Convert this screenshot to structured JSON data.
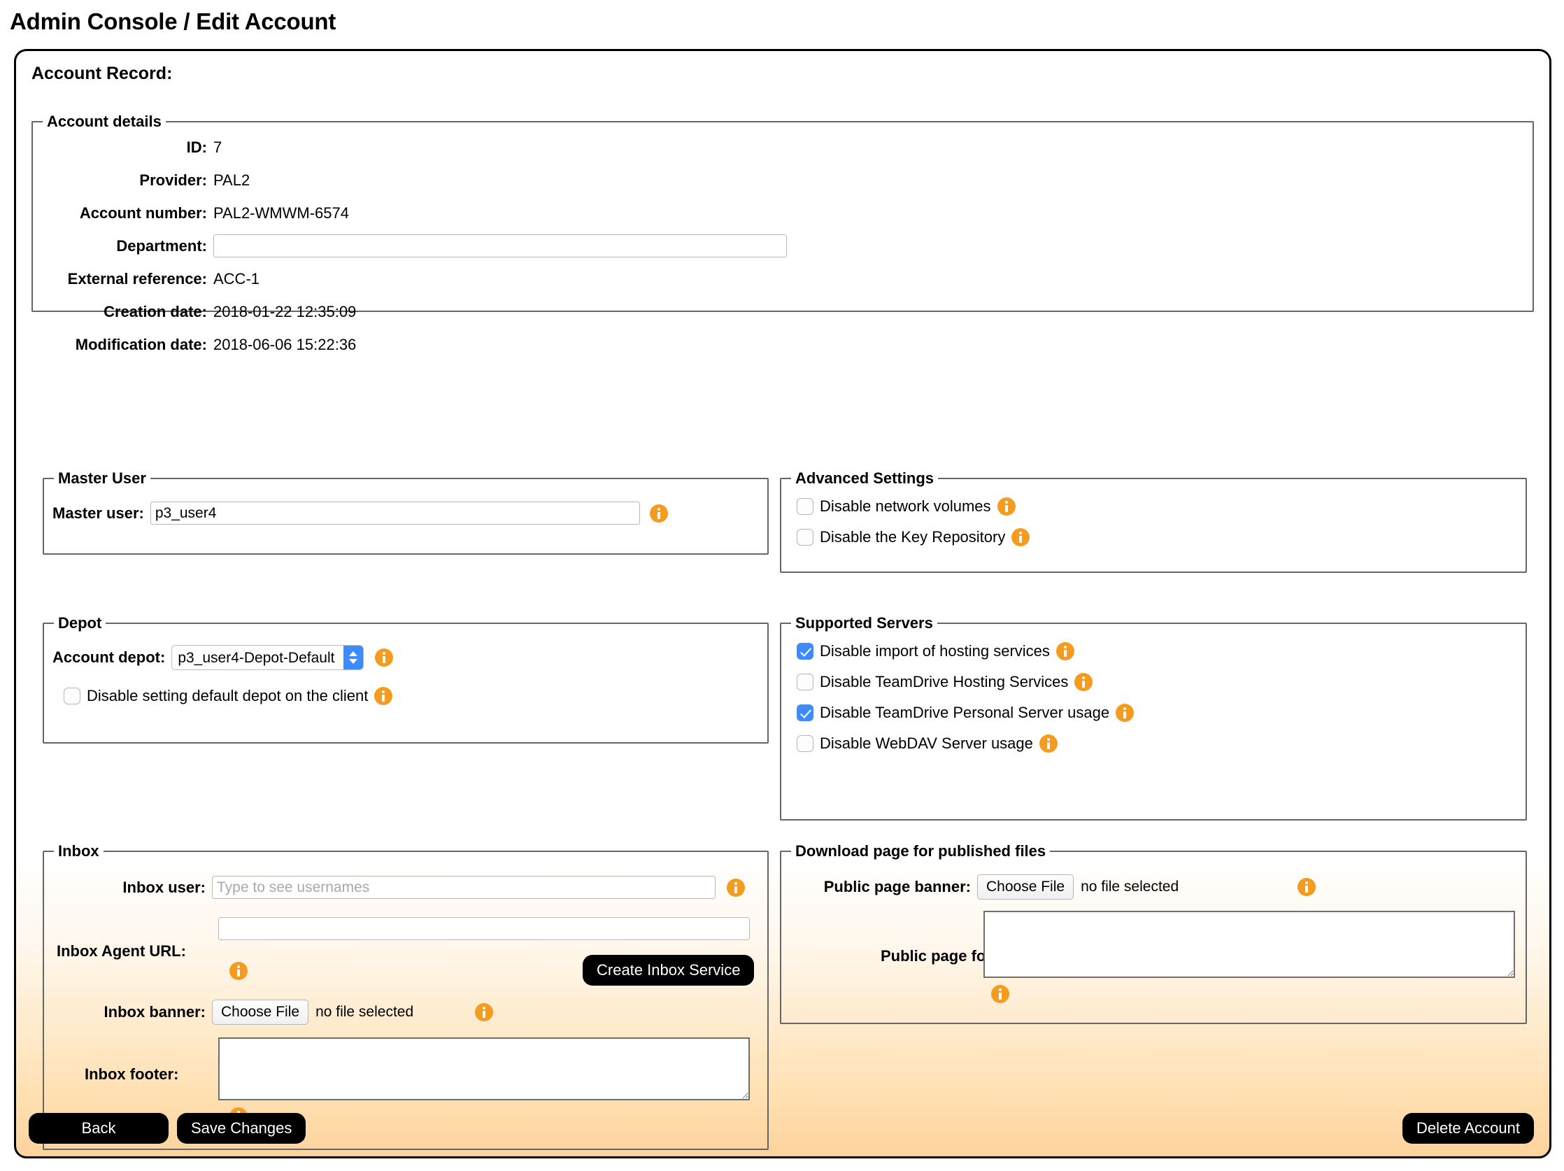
{
  "page": {
    "title": "Admin Console / Edit Account",
    "record_heading": "Account Record:"
  },
  "account_details": {
    "legend": "Account details",
    "rows": [
      {
        "label": "ID:",
        "value": "7"
      },
      {
        "label": "Provider:",
        "value": "PAL2"
      },
      {
        "label": "Account number:",
        "value": "PAL2-WMWM-6574"
      },
      {
        "label": "External reference:",
        "value": "ACC-1"
      },
      {
        "label": "Creation date:",
        "value": "2018-01-22 12:35:09"
      },
      {
        "label": "Modification date:",
        "value": "2018-06-06 15:22:36"
      }
    ],
    "department_label": "Department:",
    "department_value": "",
    "department_placeholder": ""
  },
  "master_user": {
    "legend": "Master User",
    "label": "Master user:",
    "value": "p3_user4"
  },
  "depot": {
    "legend": "Depot",
    "label": "Account depot:",
    "selected": "p3_user4-Depot-Default",
    "checkbox_label": "Disable setting default depot on the client",
    "checkbox_checked": false
  },
  "advanced_settings": {
    "legend": "Advanced Settings",
    "items": [
      {
        "label": "Disable network volumes",
        "checked": false
      },
      {
        "label": "Disable the Key Repository",
        "checked": false
      }
    ]
  },
  "supported_servers": {
    "legend": "Supported Servers",
    "items": [
      {
        "label": "Disable import of hosting services",
        "checked": true
      },
      {
        "label": "Disable TeamDrive Hosting Services",
        "checked": false
      },
      {
        "label": "Disable TeamDrive Personal Server usage",
        "checked": true
      },
      {
        "label": "Disable WebDAV Server usage",
        "checked": false
      }
    ]
  },
  "inbox": {
    "legend": "Inbox",
    "user_label": "Inbox user:",
    "user_value": "",
    "user_placeholder": "Type to see usernames",
    "agent_url_label": "Inbox Agent URL:",
    "agent_url_value": "",
    "create_service_button": "Create Inbox Service",
    "banner_label": "Inbox banner:",
    "banner_button": "Choose File",
    "banner_status": "no file selected",
    "footer_label": "Inbox footer:",
    "footer_value": ""
  },
  "download_page": {
    "legend": "Download page for published files",
    "banner_label": "Public page banner:",
    "banner_button": "Choose File",
    "banner_status": "no file selected",
    "footer_label": "Public page footer:",
    "footer_value": ""
  },
  "actions": {
    "back": "Back",
    "save": "Save Changes",
    "delete": "Delete Account"
  },
  "colors": {
    "info_icon": "#f59b20",
    "checkbox_checked": "#3e8bff",
    "button_black": "#000000",
    "frame_gradient_bottom": "#fcd29b"
  }
}
